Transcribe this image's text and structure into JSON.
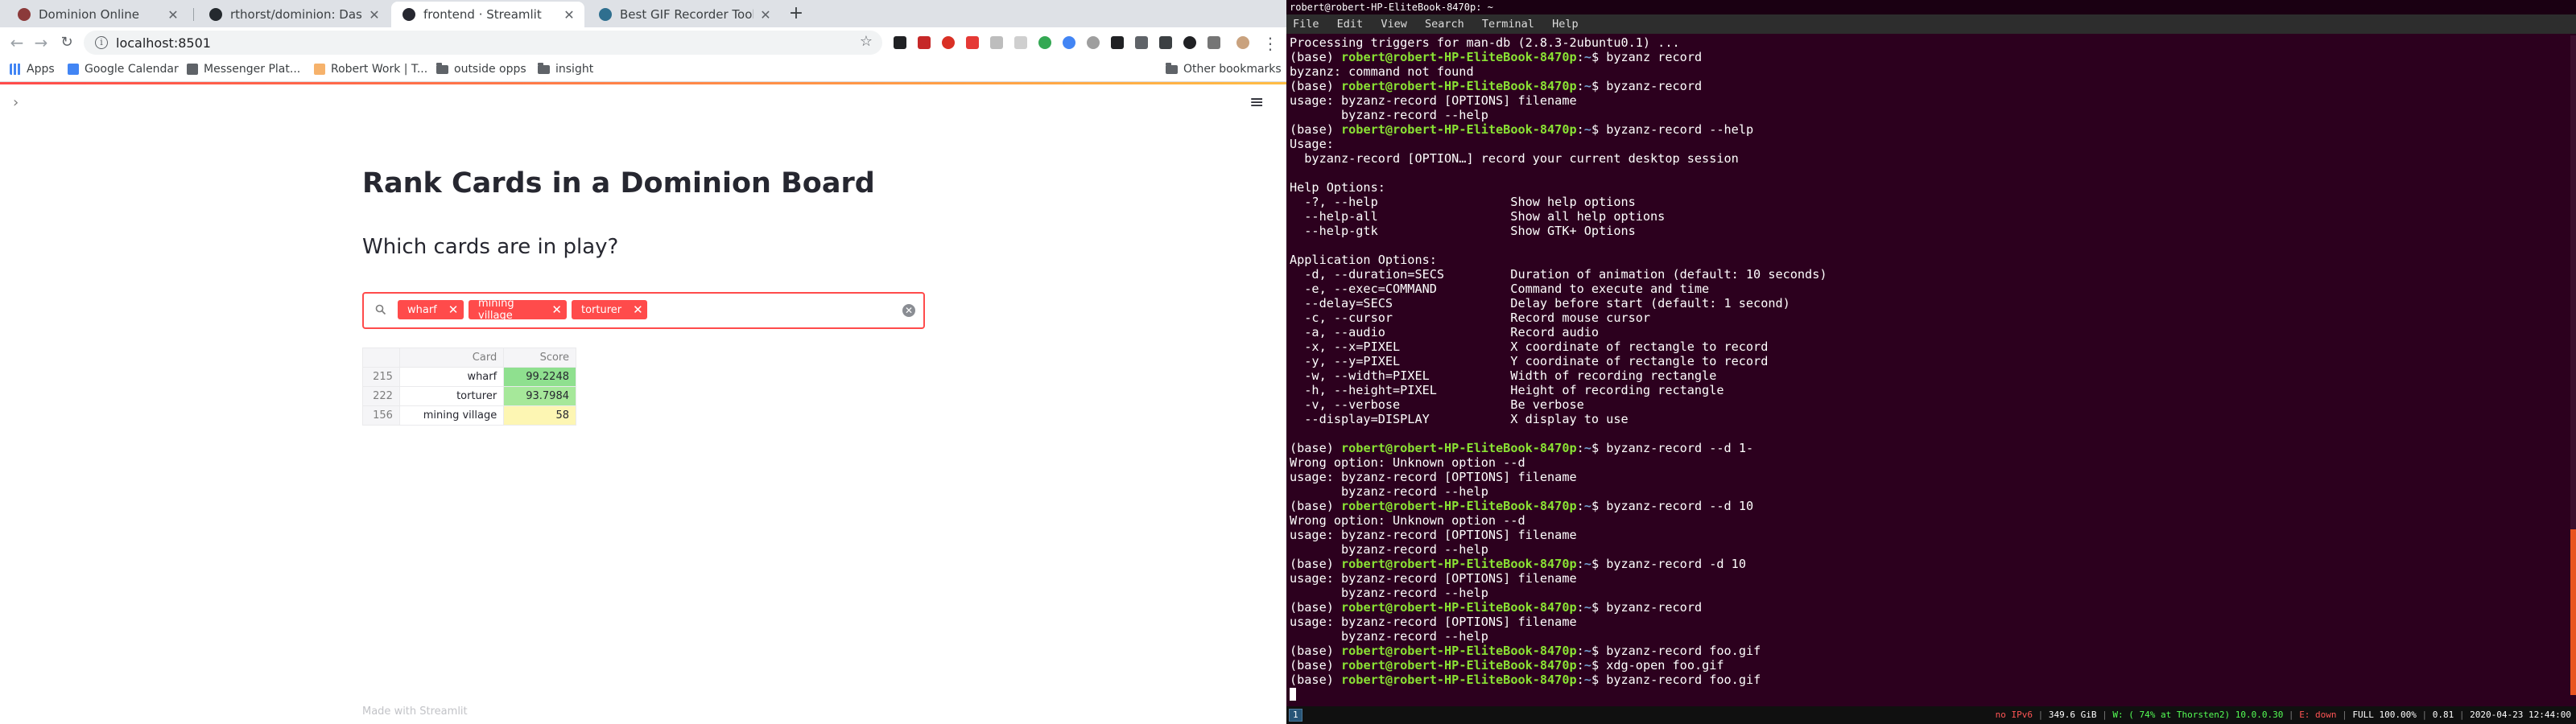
{
  "browser": {
    "tabs": [
      {
        "title": "Dominion Online",
        "favicon_color": "#8b3a3a",
        "active": false
      },
      {
        "title": "rthorst/dominion: Dashboa",
        "favicon_color": "#24292e",
        "active": false
      },
      {
        "title": "frontend · Streamlit",
        "favicon_color": "#262730",
        "active": true
      },
      {
        "title": "Best GIF Recorder Tools for",
        "favicon_color": "#2f6f8f",
        "active": false
      }
    ],
    "close_glyph": "✕",
    "new_tab_glyph": "+",
    "url": "localhost:8501",
    "bookmarks": [
      {
        "label": "Apps",
        "icon": "apps-grid-icon"
      },
      {
        "label": "Google Calendar",
        "icon": "calendar-icon"
      },
      {
        "label": "Messenger Plat...",
        "icon": "messenger-icon"
      },
      {
        "label": "Robert Work | T...",
        "icon": "bookmark-favicon-icon"
      },
      {
        "label": "outside opps",
        "icon": "folder-icon"
      },
      {
        "label": "insight",
        "icon": "folder-icon"
      }
    ],
    "other_bookmarks": "Other bookmarks"
  },
  "app": {
    "title": "Rank Cards in a Dominion Board",
    "subheader": "Which cards are in play?",
    "selected_cards": [
      "wharf",
      "mining village",
      "torturer"
    ],
    "table": {
      "columns": [
        "Card",
        "Score"
      ],
      "rows": [
        {
          "index": "215",
          "card": "wharf",
          "score": "99.2248",
          "color": "#8fe08f"
        },
        {
          "index": "222",
          "card": "torturer",
          "score": "93.7984",
          "color": "#a6e89a"
        },
        {
          "index": "156",
          "card": "mining village",
          "score": "58",
          "color": "#fdf6b3"
        }
      ]
    },
    "footer": "Made with Streamlit",
    "accent_color": "#ff4b4b"
  },
  "terminal": {
    "title": "robert@robert-HP-EliteBook-8470p: ~",
    "menu": [
      "File",
      "Edit",
      "View",
      "Search",
      "Terminal",
      "Help"
    ],
    "prompt": {
      "env": "(base) ",
      "user": "robert@robert-HP-EliteBook-8470p",
      "sep": ":",
      "path": "~",
      "dollar": "$ "
    },
    "lines": [
      {
        "text": "Processing triggers for man-db (2.8.3-2ubuntu0.1) ..."
      },
      {
        "prompt": true,
        "cmd": "byzanz record"
      },
      {
        "text": "byzanz: command not found"
      },
      {
        "prompt": true,
        "cmd": "byzanz-record"
      },
      {
        "text": "usage: byzanz-record [OPTIONS] filename"
      },
      {
        "text": "       byzanz-record --help"
      },
      {
        "prompt": true,
        "cmd": "byzanz-record --help"
      },
      {
        "text": "Usage:"
      },
      {
        "text": "  byzanz-record [OPTION…] record your current desktop session"
      },
      {
        "text": ""
      },
      {
        "text": "Help Options:"
      },
      {
        "text": "  -?, --help                  Show help options"
      },
      {
        "text": "  --help-all                  Show all help options"
      },
      {
        "text": "  --help-gtk                  Show GTK+ Options"
      },
      {
        "text": ""
      },
      {
        "text": "Application Options:"
      },
      {
        "text": "  -d, --duration=SECS         Duration of animation (default: 10 seconds)"
      },
      {
        "text": "  -e, --exec=COMMAND          Command to execute and time"
      },
      {
        "text": "  --delay=SECS                Delay before start (default: 1 second)"
      },
      {
        "text": "  -c, --cursor                Record mouse cursor"
      },
      {
        "text": "  -a, --audio                 Record audio"
      },
      {
        "text": "  -x, --x=PIXEL               X coordinate of rectangle to record"
      },
      {
        "text": "  -y, --y=PIXEL               Y coordinate of rectangle to record"
      },
      {
        "text": "  -w, --width=PIXEL           Width of recording rectangle"
      },
      {
        "text": "  -h, --height=PIXEL          Height of recording rectangle"
      },
      {
        "text": "  -v, --verbose               Be verbose"
      },
      {
        "text": "  --display=DISPLAY           X display to use"
      },
      {
        "text": ""
      },
      {
        "prompt": true,
        "cmd": "byzanz-record --d 1-"
      },
      {
        "text": "Wrong option: Unknown option --d"
      },
      {
        "text": "usage: byzanz-record [OPTIONS] filename"
      },
      {
        "text": "       byzanz-record --help"
      },
      {
        "prompt": true,
        "cmd": "byzanz-record --d 10"
      },
      {
        "text": "Wrong option: Unknown option --d"
      },
      {
        "text": "usage: byzanz-record [OPTIONS] filename"
      },
      {
        "text": "       byzanz-record --help"
      },
      {
        "prompt": true,
        "cmd": "byzanz-record -d 10"
      },
      {
        "text": "usage: byzanz-record [OPTIONS] filename"
      },
      {
        "text": "       byzanz-record --help"
      },
      {
        "prompt": true,
        "cmd": "byzanz-record"
      },
      {
        "text": "usage: byzanz-record [OPTIONS] filename"
      },
      {
        "text": "       byzanz-record --help"
      },
      {
        "prompt": true,
        "cmd": "byzanz-record foo.gif"
      },
      {
        "prompt": true,
        "cmd": "xdg-open foo.gif"
      },
      {
        "prompt": true,
        "cmd": "byzanz-record foo.gif"
      },
      {
        "cursor": true
      }
    ],
    "statusbar": {
      "workspace": "1",
      "segments": [
        {
          "text": "no IPv6",
          "color": "#ff5555"
        },
        {
          "text": "349.6 GiB",
          "color": "#ffffff"
        },
        {
          "text": "W: ( 74% at Thorsten2) 10.0.0.30",
          "color": "#55ff55"
        },
        {
          "text": "E: down",
          "color": "#ff5555"
        },
        {
          "text": "FULL 100.00%",
          "color": "#ffffff"
        },
        {
          "text": "0.81",
          "color": "#ffffff"
        },
        {
          "text": "2020-04-23 12:44:00",
          "color": "#ffffff"
        }
      ]
    }
  }
}
